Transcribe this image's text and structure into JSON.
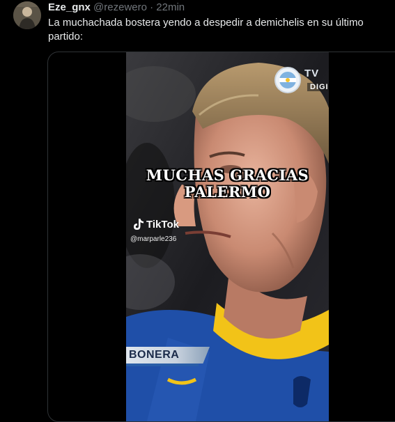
{
  "tweet": {
    "display_name": "Eze_gnx",
    "handle": "@rezewero",
    "separator": "·",
    "time": "22min",
    "text": "La muchachada bostera yendo a despedir a demichelis en su último partido:"
  },
  "video": {
    "caption_line1": "MUCHAS GRACIAS",
    "caption_line2": "PALERMO",
    "watermark_label": "TikTok",
    "watermark_handle": "@marparle236",
    "broadcast_logo_text": "TV",
    "broadcast_logo_sub": "DIGI",
    "lower_third_name": "BONERA"
  },
  "colors": {
    "background": "#000000",
    "text_primary": "#e7e9ea",
    "text_secondary": "#71767b",
    "border": "#2f3336",
    "jersey_blue": "#1f4fa8",
    "jersey_yellow": "#f2c318"
  }
}
